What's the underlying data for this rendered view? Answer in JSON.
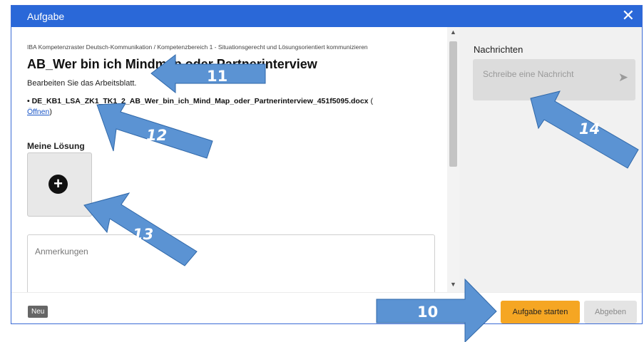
{
  "dialog": {
    "title": "Aufgabe",
    "close": "✕"
  },
  "task": {
    "breadcrumb": "IBA Kompetenzraster Deutsch-Kommunikation / Kompetenzbereich 1 - Situationsgerecht und Lösungsorientiert kommunizieren",
    "title": "AB_Wer bin ich Mindmap oder Partnerinterview",
    "instruction": "Bearbeiten Sie das Arbeitsblatt.",
    "file_name": "• DE_KB1_LSA_ZK1_TK1_2_AB_Wer_bin_ich_Mind_Map_oder_Partnerinterview_451f5095.docx",
    "file_open_prefix": "(",
    "file_open_link": "Öffnen",
    "file_open_suffix": ")"
  },
  "solution": {
    "label": "Meine Lösung",
    "add_icon": "plus-circle-icon"
  },
  "notes": {
    "placeholder": "Anmerkungen"
  },
  "messages": {
    "label": "Nachrichten",
    "placeholder": "Schreibe eine Nachricht",
    "send_icon": "send-icon"
  },
  "footer": {
    "badge": "Neu",
    "start_button": "Aufgabe starten",
    "submit_button": "Abgeben"
  },
  "annotations": {
    "a10": "10",
    "a11": "11",
    "a12": "12",
    "a13": "13",
    "a14": "14"
  },
  "colors": {
    "titlebar": "#2a68d8",
    "accent_button": "#f5a623",
    "arrow": "#5b93d3",
    "link": "#1a56c7"
  }
}
